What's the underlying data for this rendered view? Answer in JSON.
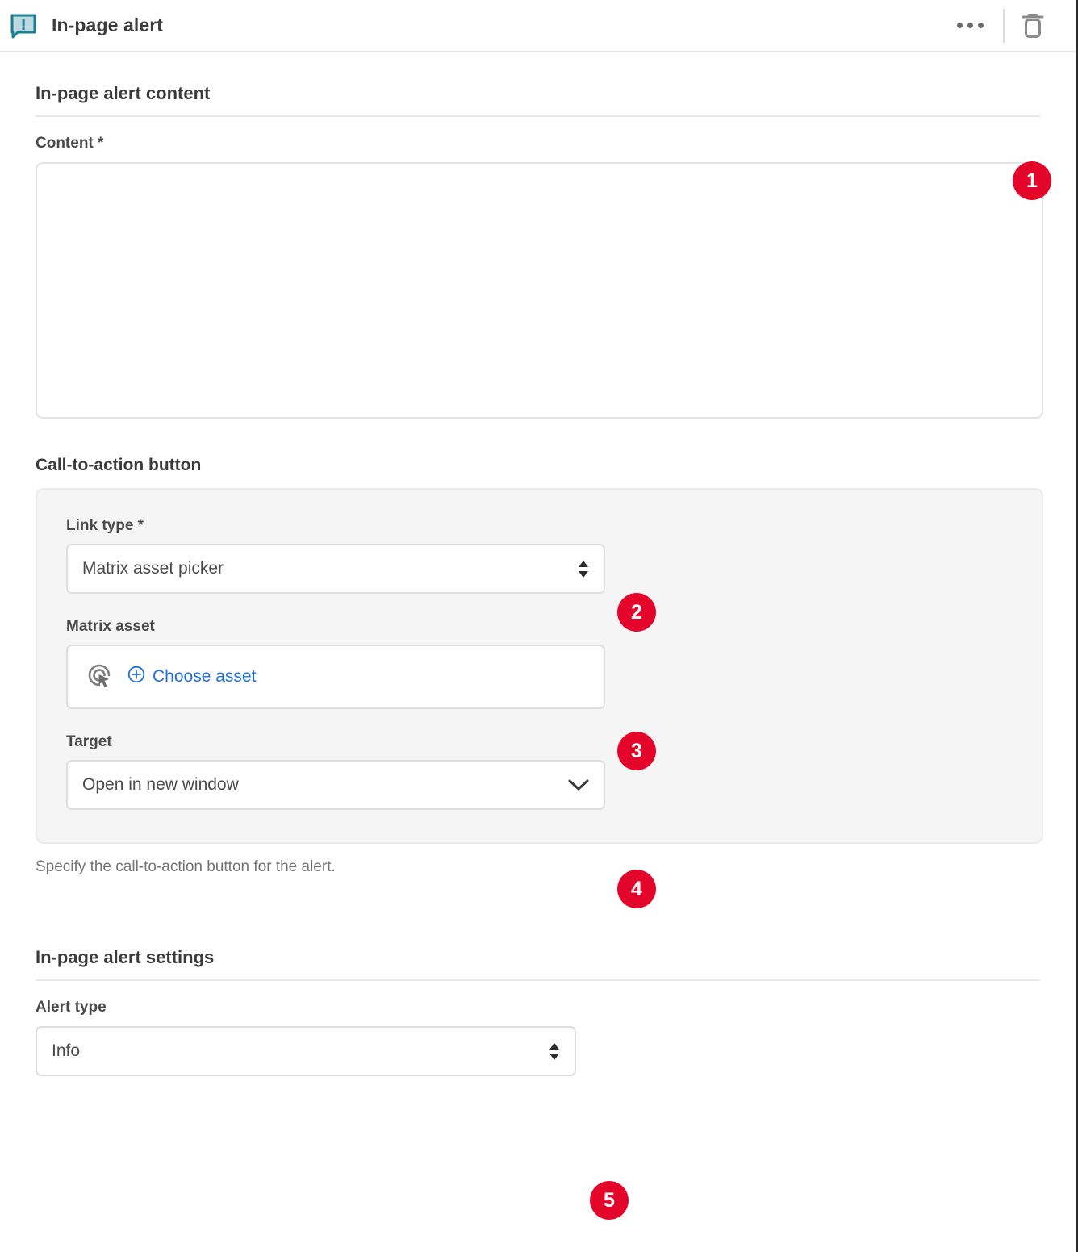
{
  "header": {
    "icon": "alert-speech-bubble-icon",
    "title": "In-page alert",
    "menu_icon": "more-options-icon",
    "delete_icon": "trash-icon",
    "icon_color": "#1a7f95"
  },
  "sections": {
    "content_section": {
      "heading": "In-page alert content",
      "content_field": {
        "label": "Content *",
        "value": "",
        "placeholder": ""
      }
    },
    "cta_section": {
      "heading": "Call-to-action button",
      "link_type": {
        "label": "Link type *",
        "value": "Matrix asset picker",
        "options": [
          "Matrix asset picker"
        ]
      },
      "matrix_asset": {
        "label": "Matrix asset",
        "icon": "asset-picker-target-icon",
        "choose_label": "Choose asset",
        "plus_icon": "plus-circle-icon"
      },
      "target": {
        "label": "Target",
        "value": "Open in new window",
        "options": [
          "Open in new window"
        ]
      },
      "helper_text": "Specify the call-to-action button for the alert."
    },
    "settings_section": {
      "heading": "In-page alert settings",
      "alert_type": {
        "label": "Alert type",
        "value": "Info",
        "options": [
          "Info"
        ]
      }
    }
  },
  "badges": {
    "one": "1",
    "two": "2",
    "three": "3",
    "four": "4",
    "five": "5",
    "color": "#e4052a"
  }
}
